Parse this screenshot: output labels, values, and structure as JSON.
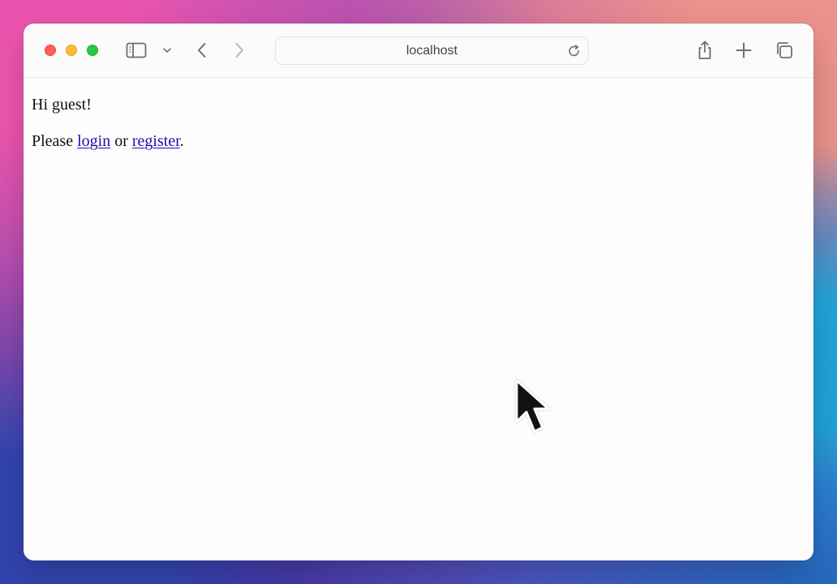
{
  "browser": {
    "address": "localhost"
  },
  "page": {
    "greeting": "Hi guest!",
    "message_prefix": "Please ",
    "login_link": "login",
    "message_middle": " or ",
    "register_link": "register",
    "message_suffix": "."
  },
  "icons": {
    "sidebar": "sidebar-icon",
    "sidebar_menu": "chevron-down-icon",
    "back": "chevron-left-icon",
    "forward": "chevron-right-icon",
    "reload": "reload-icon",
    "share": "share-icon",
    "new_tab": "plus-icon",
    "tabs": "tabs-icon",
    "pointer": "mouse-pointer-icon"
  },
  "colors": {
    "close": "#ff5f57",
    "minimize": "#febc2e",
    "maximize": "#28c840",
    "link": "#1a0dab",
    "toolbar_icon": "#6e6e6e"
  }
}
